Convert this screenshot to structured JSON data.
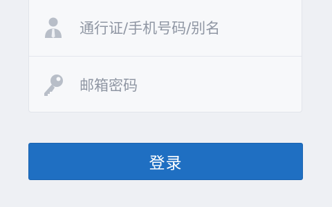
{
  "colors": {
    "background": "#eef0f4",
    "field_background": "#f7f8fa",
    "placeholder": "#8f96a3",
    "icon": "#b8bec8",
    "button": "#1f6fc2",
    "button_text": "#ffffff"
  },
  "form": {
    "account": {
      "icon": "user-icon",
      "placeholder": "通行证/手机号码/别名",
      "value": ""
    },
    "password": {
      "icon": "key-icon",
      "placeholder": "邮箱密码",
      "value": ""
    },
    "login_label": "登录"
  }
}
